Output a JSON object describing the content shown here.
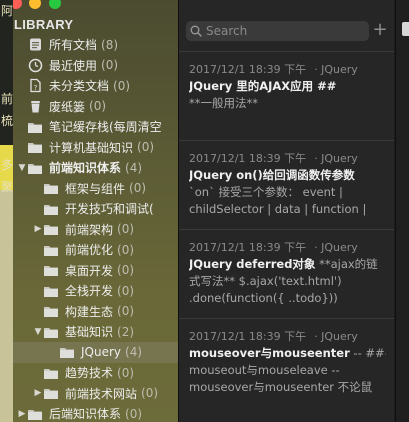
{
  "backdrop": {
    "chars": [
      "阿",
      "",
      "",
      "",
      "前",
      "梳",
      "",
      "多",
      "聚",
      "",
      "",
      "",
      "",
      "",
      "",
      "",
      "",
      "",
      ""
    ]
  },
  "sidebar": {
    "title": "LIBRARY",
    "items": [
      {
        "label": "所有文档",
        "count": "(8)",
        "icon": "document-stack-icon",
        "indent": 0,
        "arrow": ""
      },
      {
        "label": "最近使用",
        "count": "(0)",
        "icon": "clock-icon",
        "indent": 0,
        "arrow": ""
      },
      {
        "label": "未分类文档",
        "count": "(0)",
        "icon": "uncategorized-doc-icon",
        "indent": 0,
        "arrow": ""
      },
      {
        "label": "废纸篓",
        "count": "(0)",
        "icon": "trash-icon",
        "indent": 0,
        "arrow": ""
      },
      {
        "label": "笔记缓存栈(每周清空",
        "count": "",
        "icon": "folder-icon",
        "indent": 0,
        "arrow": ""
      },
      {
        "label": "计算机基础知识",
        "count": "(0)",
        "icon": "folder-icon",
        "indent": 0,
        "arrow": ""
      },
      {
        "label": "前端知识体系",
        "count": "(4)",
        "icon": "folder-icon",
        "indent": 0,
        "arrow": "▼",
        "bold": true
      },
      {
        "label": "框架与组件",
        "count": "(0)",
        "icon": "folder-icon",
        "indent": 1,
        "arrow": ""
      },
      {
        "label": "开发技巧和调试(",
        "count": "",
        "icon": "folder-icon",
        "indent": 1,
        "arrow": ""
      },
      {
        "label": "前端架构",
        "count": "(0)",
        "icon": "folder-icon",
        "indent": 1,
        "arrow": "▶"
      },
      {
        "label": "前端优化",
        "count": "(0)",
        "icon": "folder-icon",
        "indent": 1,
        "arrow": ""
      },
      {
        "label": "桌面开发",
        "count": "(0)",
        "icon": "folder-icon",
        "indent": 1,
        "arrow": ""
      },
      {
        "label": "全栈开发",
        "count": "(0)",
        "icon": "folder-icon",
        "indent": 1,
        "arrow": ""
      },
      {
        "label": "构建生态",
        "count": "(0)",
        "icon": "folder-icon",
        "indent": 1,
        "arrow": ""
      },
      {
        "label": "基础知识",
        "count": "(2)",
        "icon": "folder-icon",
        "indent": 1,
        "arrow": "▼"
      },
      {
        "label": "JQuery",
        "count": "(4)",
        "icon": "folder-icon",
        "indent": 2,
        "arrow": "",
        "selected": true
      },
      {
        "label": "趋势技术",
        "count": "(0)",
        "icon": "folder-icon",
        "indent": 1,
        "arrow": ""
      },
      {
        "label": "前端技术网站",
        "count": "(0)",
        "icon": "folder-icon",
        "indent": 1,
        "arrow": "▶"
      },
      {
        "label": "后端知识体系",
        "count": "(0)",
        "icon": "folder-icon",
        "indent": 0,
        "arrow": "▶"
      }
    ]
  },
  "search": {
    "placeholder": "Search"
  },
  "toolbar": {
    "add_label": "+"
  },
  "notes": [
    {
      "date": "2017/12/1 18:39 下午",
      "tag": "· JQuery",
      "title": "JQuery 里的AJAX应用 ##",
      "lines": [
        "**一般用法**"
      ]
    },
    {
      "date": "2017/12/1 18:39 下午",
      "tag": "· JQuery",
      "title": "JQuery on()给回调函数传参数",
      "lines": [
        "`on` 接受三个参数： event |",
        "childSelector | data | function |"
      ]
    },
    {
      "date": "2017/12/1 18:39 下午",
      "tag": "· JQuery",
      "title": "JQuery deferred对象",
      "title_suffix": " **ajax的链",
      "lines": [
        "式写法**    $.ajax('text.html')",
        "          .done(function({ ..todo}))"
      ]
    },
    {
      "date": "2017/12/1 18:39 下午",
      "tag": "· JQuery",
      "title": "mouseover与mouseenter",
      "title_suffix": " -- ###",
      "lines": [
        "mouseout与mouseleave --",
        "mouseover与mouseenter  不论鼠"
      ]
    }
  ],
  "colors": {
    "accent_red": "#fe5f57",
    "accent_yellow": "#febc2e",
    "accent_green": "#28c840"
  }
}
